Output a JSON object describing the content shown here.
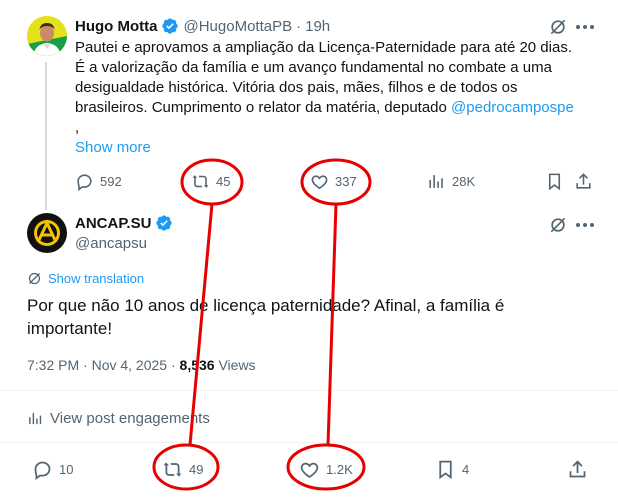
{
  "tweet1": {
    "author_name": "Hugo Motta",
    "handle": "@HugoMottaPB",
    "separator": "·",
    "time": "19h",
    "lines": [
      "Pautei e aprovamos a ampliação da Licença-Paternidade para até 20 dias.",
      "É a valorização da família e um avanço fundamental no combate a uma",
      "desigualdade histórica. Vitória dos pais, mães, filhos e de todos os",
      "brasileiros. Cumprimento o relator da matéria, deputado "
    ],
    "mention": "@pedrocampospe",
    "trailing": ",",
    "show_more": "Show more",
    "replies": "592",
    "reposts": "45",
    "likes": "337",
    "views": "28K"
  },
  "tweet2": {
    "author_name": "ANCAP.SU",
    "handle": "@ancapsu",
    "show_translation": "Show translation",
    "text_line1": "Por que não 10 anos de licença paternidade? Afinal, a família é",
    "text_line2": "importante!",
    "time": "7:32 PM · Nov 4, 2025 · ",
    "views_count": "8,536",
    "views_label": " Views",
    "engagements": "View post engagements",
    "replies": "10",
    "reposts": "49",
    "likes": "1.2K",
    "bookmarks": "4"
  },
  "colors": {
    "text": "#0f1419",
    "muted": "#536471",
    "link": "#1d9bf0",
    "verified": "#1d9bf0",
    "annotation": "#e60000"
  },
  "icons": [
    "verified-badge-icon",
    "grok-icon",
    "more-icon",
    "reply-icon",
    "repost-icon",
    "like-icon",
    "views-icon",
    "bookmark-icon",
    "share-icon",
    "translate-icon",
    "engagements-icon"
  ]
}
